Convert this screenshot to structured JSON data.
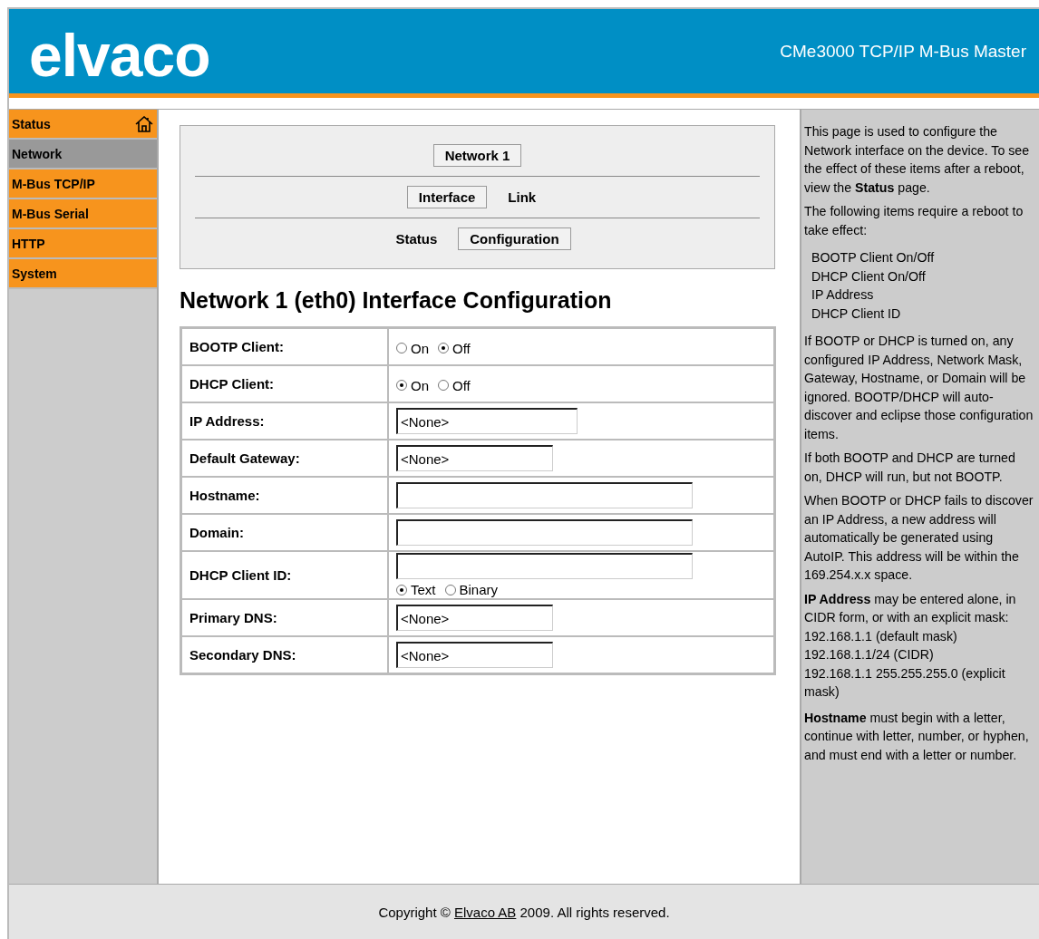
{
  "header": {
    "logo": "elvaco",
    "product": "CMe3000 TCP/IP M-Bus Master"
  },
  "sidebar": {
    "items": [
      {
        "label": "Status",
        "selected": false,
        "home": true
      },
      {
        "label": "Network",
        "selected": true
      },
      {
        "label": "M-Bus TCP/IP",
        "selected": false
      },
      {
        "label": "M-Bus Serial",
        "selected": false
      },
      {
        "label": "HTTP",
        "selected": false
      },
      {
        "label": "System",
        "selected": false
      }
    ]
  },
  "nav": {
    "rows": [
      [
        {
          "label": "Network 1",
          "selected": true
        }
      ],
      [
        {
          "label": "Interface",
          "selected": true
        },
        {
          "label": "Link",
          "selected": false
        }
      ],
      [
        {
          "label": "Status",
          "selected": false
        },
        {
          "label": "Configuration",
          "selected": true
        }
      ]
    ]
  },
  "heading": "Network 1 (eth0) Interface Configuration",
  "form": {
    "rows": [
      {
        "kind": "radio",
        "label": "BOOTP Client:",
        "options": [
          {
            "label": "On",
            "selected": false
          },
          {
            "label": "Off",
            "selected": true
          }
        ]
      },
      {
        "kind": "radio",
        "label": "DHCP Client:",
        "options": [
          {
            "label": "On",
            "selected": true
          },
          {
            "label": "Off",
            "selected": false
          }
        ]
      },
      {
        "kind": "text",
        "label": "IP Address:",
        "value": "<None>"
      },
      {
        "kind": "text",
        "label": "Default Gateway:",
        "value": "<None>"
      },
      {
        "kind": "text",
        "label": "Hostname:"
      },
      {
        "kind": "text",
        "label": "Domain:"
      },
      {
        "kind": "text-radio",
        "label": "DHCP Client ID:",
        "options": [
          {
            "label": "Text",
            "selected": true
          },
          {
            "label": "Binary",
            "selected": false
          }
        ]
      },
      {
        "kind": "text",
        "label": "Primary DNS:",
        "value": "<None>"
      },
      {
        "kind": "text",
        "label": "Secondary DNS:",
        "value": "<None>"
      }
    ]
  },
  "help": [
    {
      "kind": "paragraph",
      "text": "This page is used to configure the Network interface on the device. To see the effect of these items after a reboot, view the **Status** page."
    },
    {
      "kind": "paragraph",
      "text": "The following items require a reboot to take effect:"
    },
    {
      "kind": "list",
      "items": [
        "BOOTP Client On/Off",
        "DHCP Client On/Off",
        "IP Address",
        "DHCP Client ID"
      ]
    },
    {
      "kind": "paragraph",
      "text": "If BOOTP or DHCP is turned on, any configured IP Address, Network Mask, Gateway, Hostname, or Domain will be ignored. BOOTP/DHCP will auto-discover and eclipse those configuration items."
    },
    {
      "kind": "paragraph",
      "text": "If both BOOTP and DHCP are turned on, DHCP will run, but not BOOTP."
    },
    {
      "kind": "paragraph",
      "text": "When BOOTP or DHCP fails to discover an IP Address, a new address will automatically be generated using AutoIP. This address will be within the 169.254.x.x space."
    },
    {
      "kind": "paragraph",
      "text": "**IP Address** may be entered alone, in CIDR form, or with an explicit mask:",
      "lines": [
        "192.168.1.1 (default mask)",
        "192.168.1.1/24 (CIDR)",
        "192.168.1.1 255.255.255.0 (explicit mask)"
      ]
    },
    {
      "kind": "paragraph",
      "text": "**Hostname** must begin with a letter, continue with letter, number, or hyphen, and must end with a letter or number."
    }
  ],
  "footer": {
    "before": "Copyright ©",
    "link": "Elvaco AB",
    "after": "2009. All rights reserved."
  }
}
